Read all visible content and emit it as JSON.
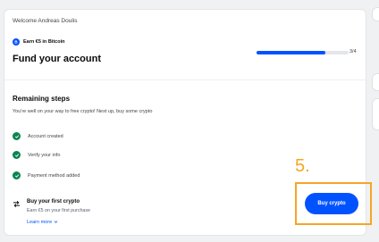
{
  "header": {
    "welcome": "Welcome Andreas Doulis"
  },
  "promo": {
    "earn_label": "Earn €5 in Bitcoin",
    "coin_icon": "bitcoin-icon"
  },
  "fund": {
    "title": "Fund your account"
  },
  "progress": {
    "text": "3/4",
    "fraction": 0.75
  },
  "steps": {
    "title": "Remaining steps",
    "subtitle": "You're well on your way to free crypto! Next up, buy some crypto",
    "items": [
      {
        "label": "Account created",
        "status": "done"
      },
      {
        "label": "Verify your info",
        "status": "done"
      },
      {
        "label": "Payment method added",
        "status": "done"
      }
    ]
  },
  "buy": {
    "title": "Buy your first crypto",
    "subtitle": "Earn €5 on your first purchase",
    "learn_more": "Learn more",
    "button_label": "Buy crypto"
  },
  "annotation": {
    "label": "5."
  },
  "colors": {
    "accent": "#0052ff",
    "success": "#098551",
    "annotation": "#f5a623"
  }
}
